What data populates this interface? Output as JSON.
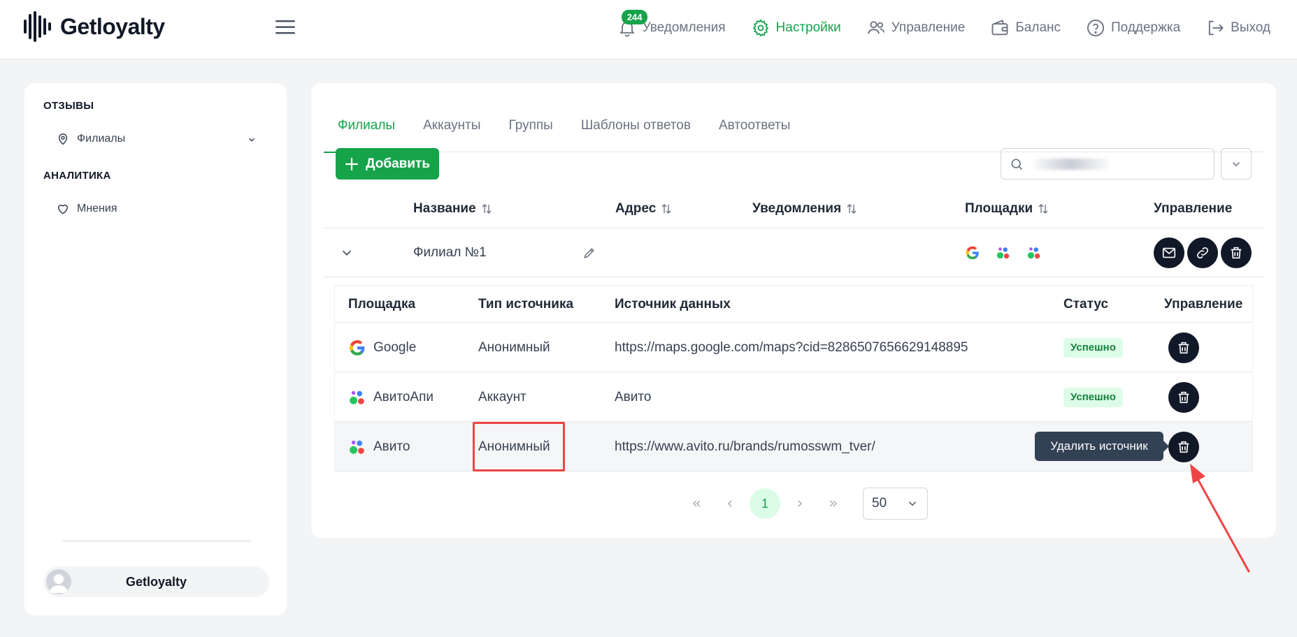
{
  "brand": {
    "name": "Getloyalty",
    "accent": "#16a34a"
  },
  "nav": {
    "notifications_label": "Уведомления",
    "notifications_count": "244",
    "settings_label": "Настройки",
    "management_label": "Управление",
    "balance_label": "Баланс",
    "support_label": "Поддержка",
    "logout_label": "Выход"
  },
  "sidebar": {
    "section_reviews": "ОТЗЫВЫ",
    "item_branches": "Филиалы",
    "section_analytics": "АНАЛИТИКА",
    "item_opinions": "Мнения",
    "user_name": "Getloyalty"
  },
  "tabs": [
    "Филиалы",
    "Аккаунты",
    "Группы",
    "Шаблоны ответов",
    "Автоответы"
  ],
  "toolbar": {
    "add_label": "Добавить"
  },
  "table": {
    "headers": {
      "name": "Название",
      "address": "Адрес",
      "notifications": "Уведомления",
      "platforms": "Площадки",
      "manage": "Управление"
    },
    "row": {
      "name": "Филиал №1"
    }
  },
  "sources": {
    "headers": {
      "platform": "Площадка",
      "type": "Тип источника",
      "source": "Источник данных",
      "status": "Статус",
      "manage": "Управление"
    },
    "rows": [
      {
        "platform": "Google",
        "type": "Анонимный",
        "source": "https://maps.google.com/maps?cid=8286507656629148895",
        "status": "Успешно"
      },
      {
        "platform": "АвитоАпи",
        "type": "Аккаунт",
        "source": "Авито",
        "status": "Успешно"
      },
      {
        "platform": "Авито",
        "type": "Анонимный",
        "source": "https://www.avito.ru/brands/rumosswm_tver/",
        "status": ""
      }
    ],
    "tooltip": "Удалить источник"
  },
  "pagination": {
    "current": "1",
    "per_page": "50"
  }
}
